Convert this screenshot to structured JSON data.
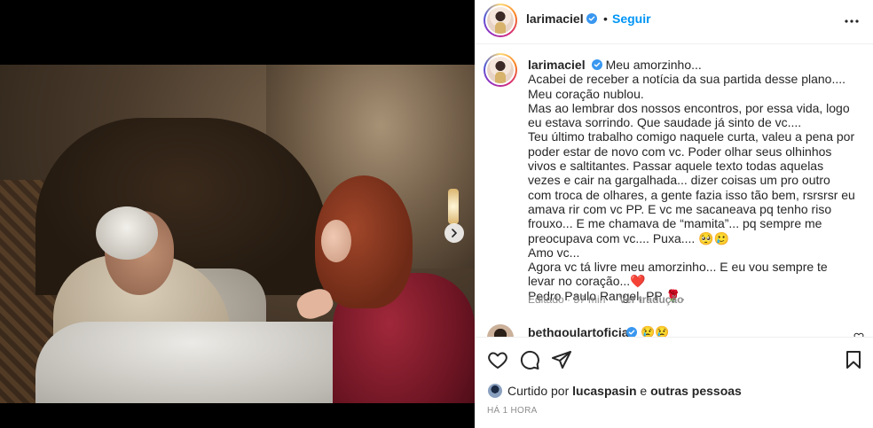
{
  "post": {
    "username": "larimaciel",
    "follow_label": "Seguir",
    "dot": "•"
  },
  "caption": {
    "username": "larimaciel",
    "lines": [
      "Meu amorzinho...",
      "Acabei de receber a notícia da sua partida desse plano....",
      "Meu coração nublou.",
      "Mas ao lembrar dos nossos encontros, por essa vida, logo eu estava sorrindo. Que saudade já sinto de vc....",
      "Teu último trabalho comigo naquele curta, valeu a pena por poder estar de novo com vc. Poder olhar seus olhinhos vivos e saltitantes. Passar aquele texto todas aquelas vezes e cair na gargalhada... dizer coisas um pro outro com troca de olhares, a gente fazia isso tão bem, rsrsrsr eu amava rir com vc PP. E vc me sacaneava pq tenho riso frouxo... E me chamava de “mamita”... pq sempre me preocupava com vc.... Puxa.... 🥺🥲",
      "Amo vc...",
      "Agora vc tá livre meu amorzinho... E eu vou sempre te levar no coração...❤️",
      "Pedro Paulo Rangel, PP 🌹."
    ],
    "edited": "Editado",
    "age": "57 min",
    "translate_label": "Ver tradução"
  },
  "comment": {
    "username": "bethgoulartoficial",
    "text": "😢😢"
  },
  "likes": {
    "prefix": "Curtido por ",
    "user": "lucaspasin",
    "joiner": " e ",
    "others": "outras pessoas"
  },
  "timestamp": "HÁ 1 HORA",
  "icons": {
    "verified": "verified-badge-icon",
    "more": "more-options-icon",
    "next": "chevron-right-icon",
    "like": "heart-icon",
    "comment": "comment-bubble-icon",
    "share": "paper-plane-icon",
    "save": "bookmark-icon"
  },
  "colors": {
    "accent": "#0095f6",
    "text": "#262626",
    "muted": "#8e8e8e",
    "heart": "#ed4956"
  }
}
